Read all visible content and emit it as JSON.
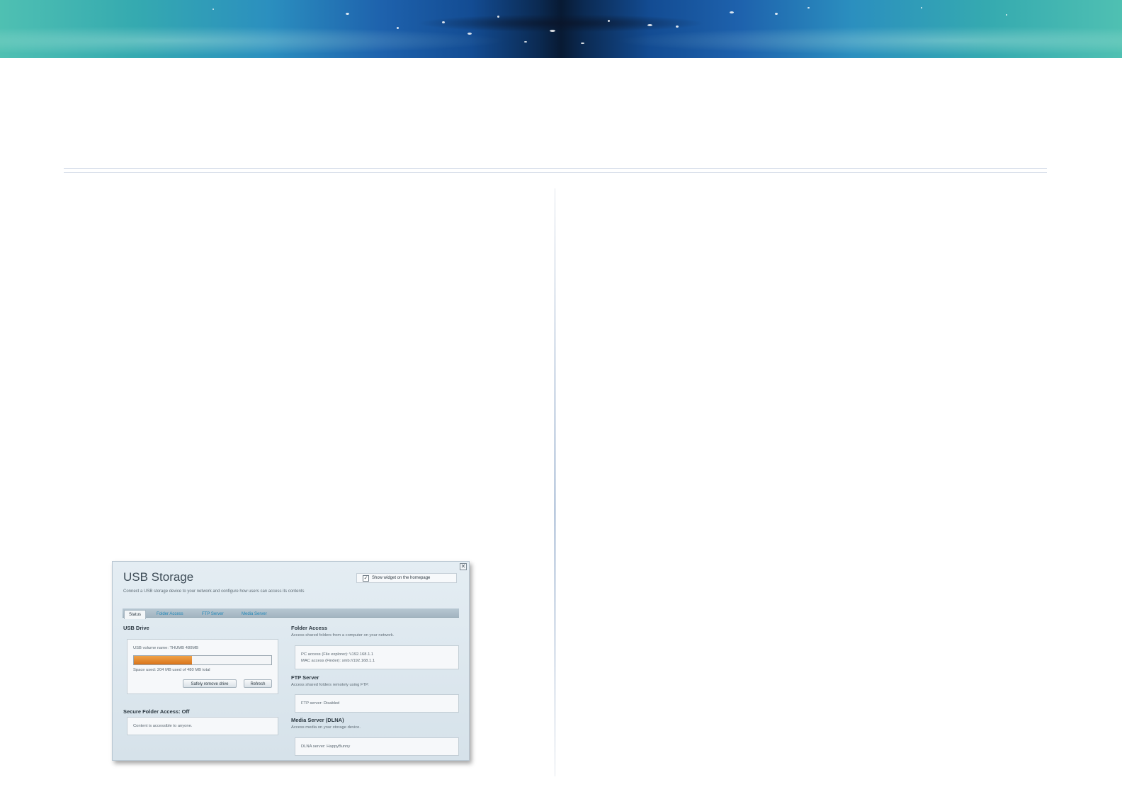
{
  "usb_storage": {
    "title": "USB Storage",
    "subtitle": "Connect a USB storage device to your network and configure how users can access its contents",
    "show_widget_label": "Show widget on the homepage",
    "show_widget_checked": true,
    "close_glyph": "✕",
    "check_glyph": "✓",
    "tabs": [
      {
        "label": "Status",
        "active": true
      },
      {
        "label": "Folder Access",
        "active": false
      },
      {
        "label": "FTP Server",
        "active": false
      },
      {
        "label": "Media Server",
        "active": false
      }
    ],
    "usb_drive": {
      "heading": "USB Drive",
      "volume_name": "USB volume name: THUMB 480MB",
      "space_used": "Space used: 204 MB used of 480 MB total",
      "used_fraction": 0.425,
      "remove_button": "Safely remove drive",
      "refresh_button": "Refresh"
    },
    "secure_folder": {
      "heading": "Secure Folder Access: Off",
      "text": "Content is accessible to anyone."
    },
    "folder_access": {
      "heading": "Folder Access",
      "desc": "Access shared folders from a computer on your network.",
      "pc_access": "PC access (File explorer): \\\\192.168.1.1",
      "mac_access": "MAC access (Finder): smb://192.168.1.1"
    },
    "ftp_server": {
      "heading": "FTP Server",
      "desc": "Access shared folders remotely using FTP.",
      "status": "FTP server: Disabled"
    },
    "media_server": {
      "heading": "Media Server (DLNA)",
      "desc": "Access media on your storage device.",
      "status": "DLNA server: HappyBunny"
    },
    "colors": {
      "progress_fill": "#e0822a",
      "tab_link": "#1f86b8"
    }
  }
}
